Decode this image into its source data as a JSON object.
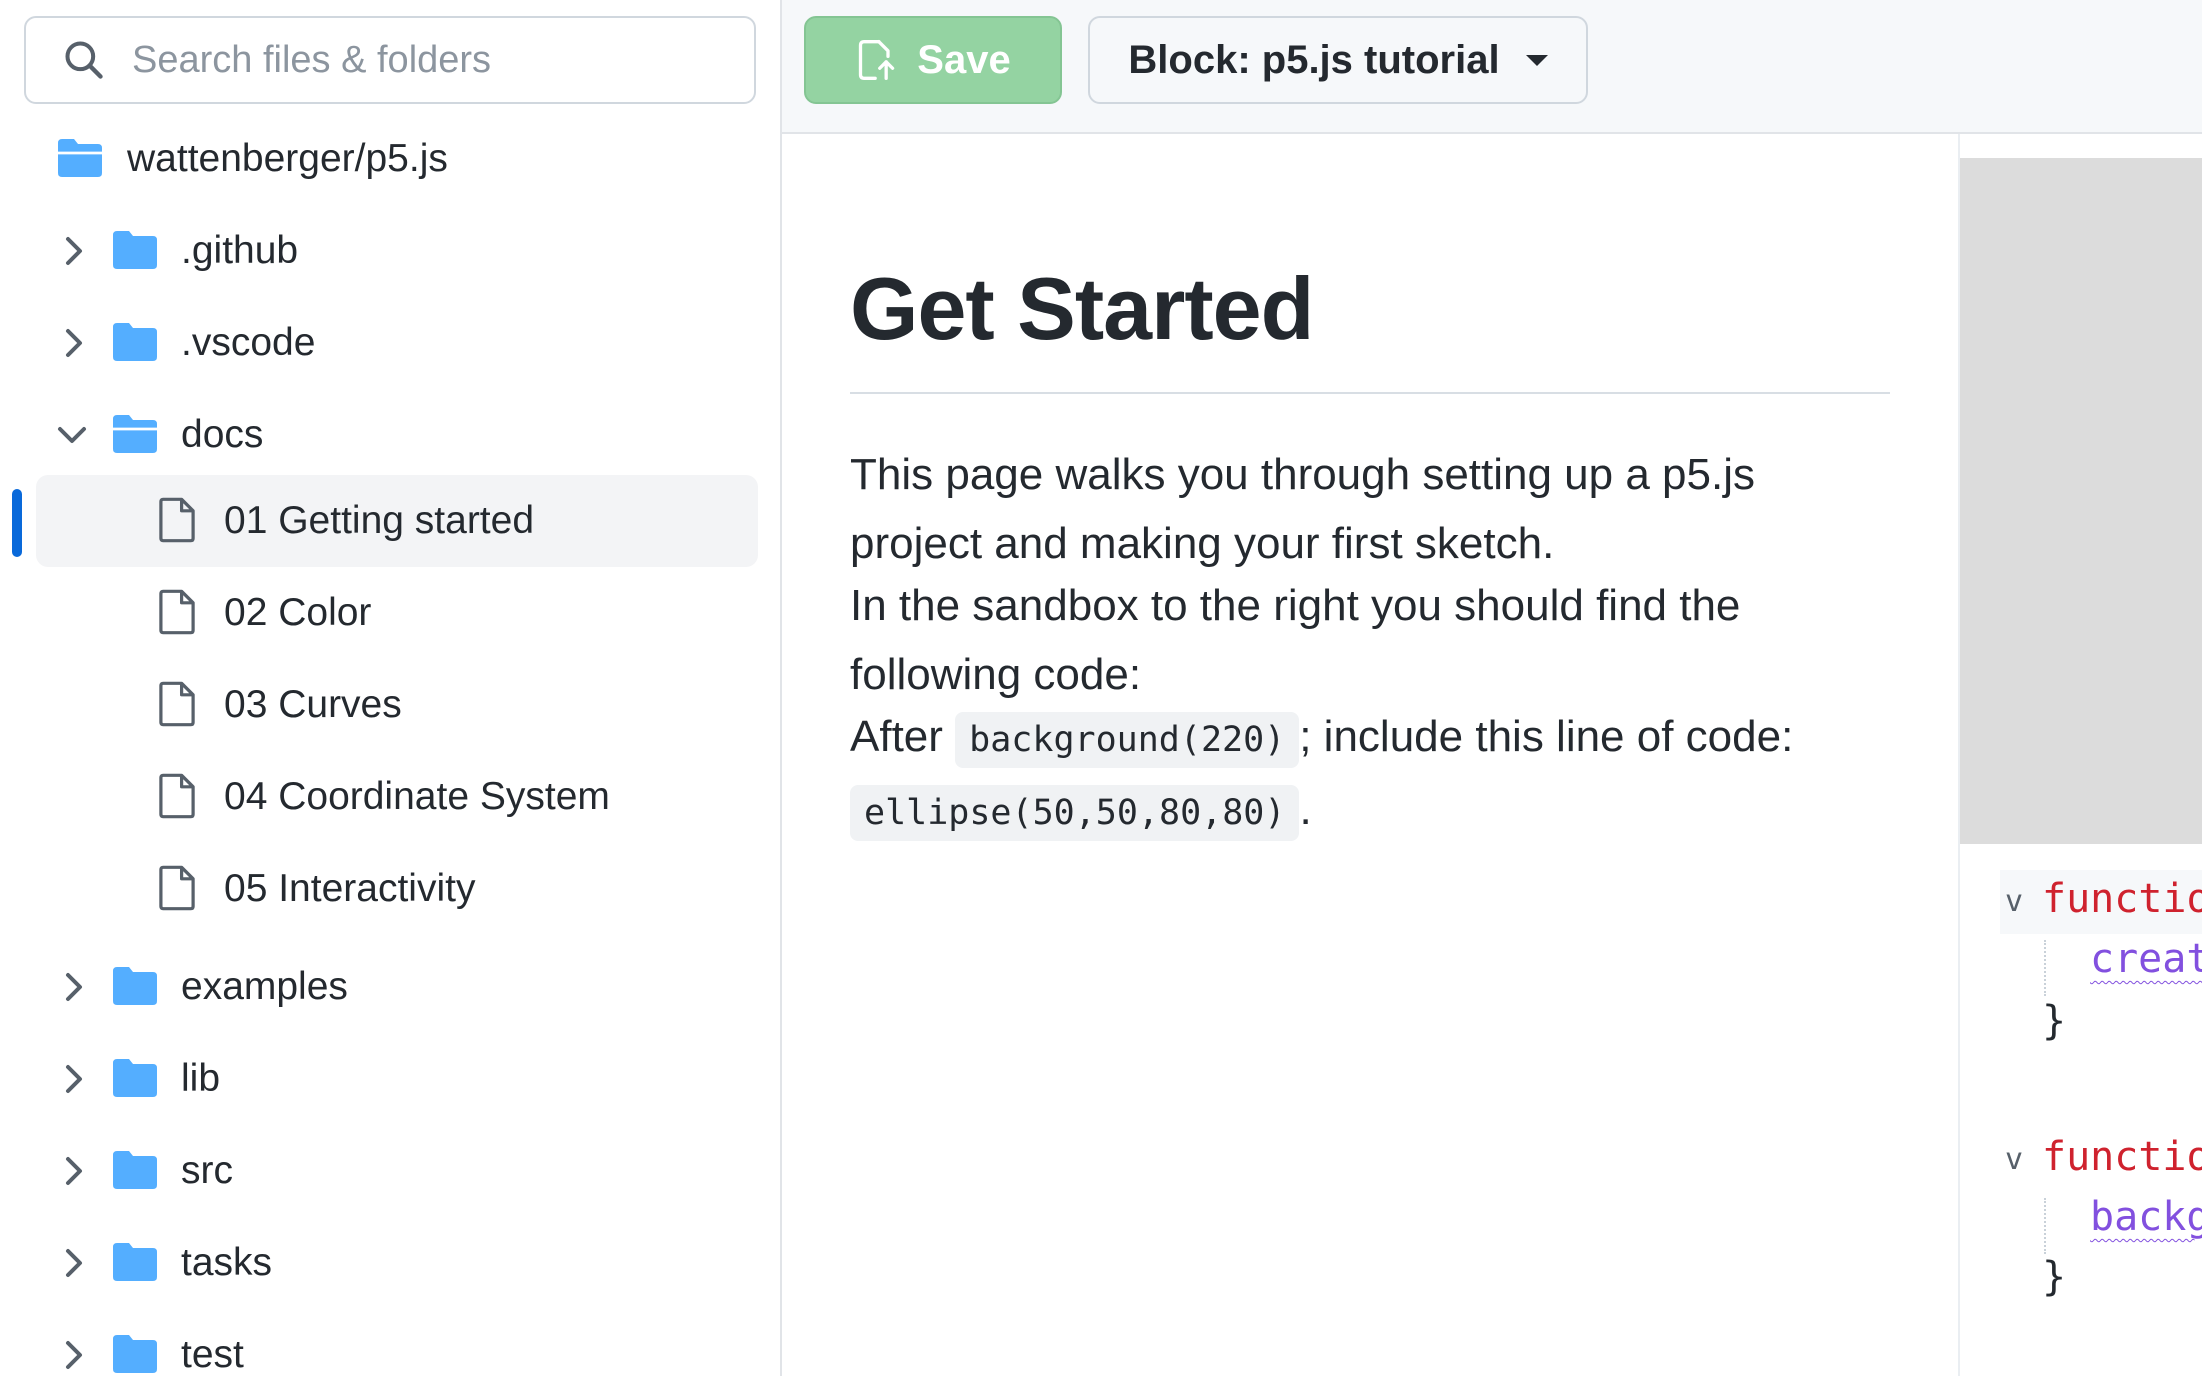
{
  "search": {
    "placeholder": "Search files & folders"
  },
  "tree": {
    "root": "wattenberger/p5.js",
    "items": [
      {
        "label": ".github"
      },
      {
        "label": ".vscode"
      },
      {
        "label": "docs"
      },
      {
        "label": "01 Getting started"
      },
      {
        "label": "02 Color"
      },
      {
        "label": "03 Curves"
      },
      {
        "label": "04 Coordinate System"
      },
      {
        "label": "05 Interactivity"
      },
      {
        "label": "examples"
      },
      {
        "label": "lib"
      },
      {
        "label": "src"
      },
      {
        "label": "tasks"
      },
      {
        "label": "test"
      }
    ]
  },
  "toolbar": {
    "save_label": "Save",
    "block_label": "Block: p5.js tutorial"
  },
  "doc": {
    "title": "Get Started",
    "p1": "This page walks you through setting up a p5.js project and making your first sketch.",
    "p2": "In the sandbox to the right you should find the following code:",
    "p3_a": "After",
    "p3_code1": "background(220)",
    "p3_b": "; include this line of code:",
    "p3_code2": "ellipse(50,50,80,80)",
    "p3_c": "."
  },
  "code": {
    "l1_kw": "functio",
    "l2_fn": "creat",
    "l3": "}",
    "l5_kw": "functio",
    "l6_fn": "backg",
    "l7": "}",
    "fold_glyph": "v"
  },
  "colors": {
    "accent": "#0969da",
    "save_bg": "#94d3a2",
    "folder": "#54aeff",
    "keyword": "#cf222e",
    "function": "#8250df"
  }
}
